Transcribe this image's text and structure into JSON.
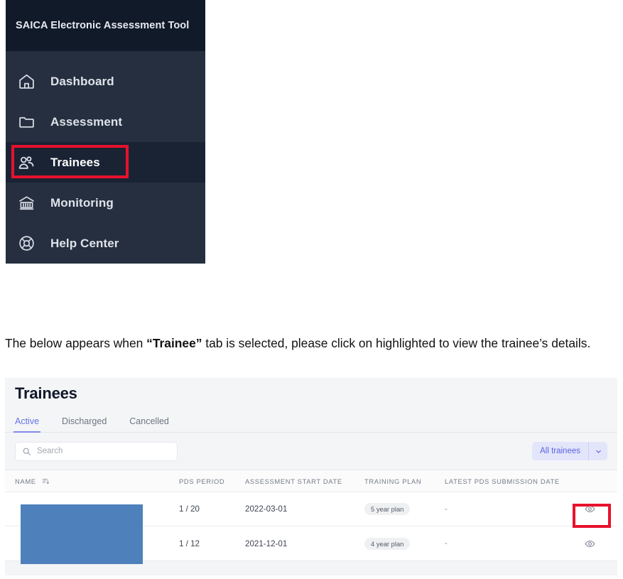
{
  "sidebar": {
    "title": "SAICA Electronic Assessment Tool",
    "items": [
      {
        "label": "Dashboard",
        "icon": "home-icon"
      },
      {
        "label": "Assessment",
        "icon": "folder-icon"
      },
      {
        "label": "Trainees",
        "icon": "users-icon"
      },
      {
        "label": "Monitoring",
        "icon": "bank-icon"
      },
      {
        "label": "Help Center",
        "icon": "lifebuoy-icon"
      }
    ],
    "active_index": 2
  },
  "caption": {
    "part1": "The below appears when ",
    "bold": "“Trainee”",
    "part2": " tab is selected, please click on highlighted to view the trainee’s details."
  },
  "panel": {
    "title": "Trainees",
    "tabs": [
      {
        "label": "Active",
        "selected": true
      },
      {
        "label": "Discharged",
        "selected": false
      },
      {
        "label": "Cancelled",
        "selected": false
      }
    ],
    "search": {
      "value": "",
      "placeholder": "Search"
    },
    "filter": {
      "label": "All trainees",
      "caret_icon": "chevron-down-icon"
    },
    "table": {
      "columns": [
        "NAME",
        "PDS PERIOD",
        "ASSESSMENT START DATE",
        "TRAINING PLAN",
        "LATEST PDS SUBMISSION DATE",
        ""
      ],
      "sort_icon": "sort-descending-icon",
      "rows": [
        {
          "name": "",
          "pds_period": "1 / 20",
          "assessment_start_date": "2022-03-01",
          "training_plan": "5 year plan",
          "latest_pds_submission_date": "-",
          "action_icon": "eye-icon"
        },
        {
          "name": "",
          "pds_period": "1 / 12",
          "assessment_start_date": "2021-12-01",
          "training_plan": "4 year plan",
          "latest_pds_submission_date": "-",
          "action_icon": "eye-icon"
        }
      ]
    }
  },
  "annotations": {
    "highlight_color": "#e8112d",
    "redaction_color": "#4e81bc"
  }
}
